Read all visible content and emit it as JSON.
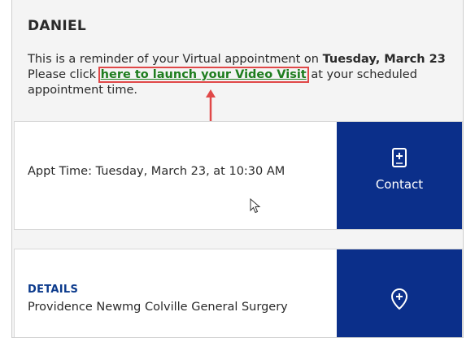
{
  "header": {
    "name": "DANIEL"
  },
  "reminder": {
    "line1_prefix": "This is a reminder of your Virtual appointment on ",
    "line1_date": "Tuesday, March 23",
    "line2_prefix": "Please click ",
    "link_label": "here to launch your Video Visit",
    "line2_suffix": " at your scheduled appointment time."
  },
  "appointment_card": {
    "time_text": "Appt Time: Tuesday, March 23, at 10:30 AM",
    "contact_label": "Contact",
    "contact_icon": "phone-plus-icon"
  },
  "details_card": {
    "label": "DETAILS",
    "location": "Providence Newmg Colville General Surgery",
    "location_icon": "map-pin-plus-icon"
  },
  "colors": {
    "accent_blue": "#0b2f8a",
    "link_green": "#1e7d1e",
    "annotation_red": "#e04848",
    "details_label_blue": "#0b3a8c"
  }
}
